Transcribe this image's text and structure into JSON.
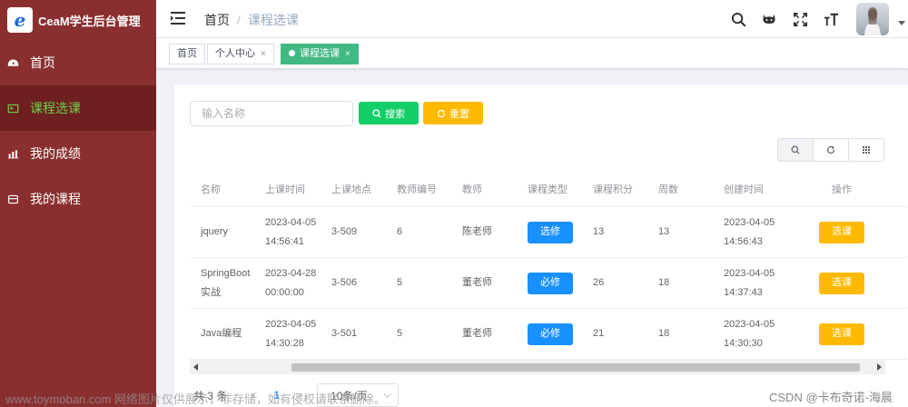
{
  "app": {
    "logo_letter": "e",
    "title": "CeaM学生后台管理"
  },
  "sidebar": {
    "items": [
      {
        "label": "首页",
        "icon": "dashboard-icon"
      },
      {
        "label": "课程选课",
        "icon": "course-icon"
      },
      {
        "label": "我的成绩",
        "icon": "bar-chart-icon"
      },
      {
        "label": "我的课程",
        "icon": "book-icon"
      }
    ],
    "active_color": "#6cd34b",
    "bg_color": "#8a2f2f"
  },
  "header": {
    "breadcrumb": {
      "home": "首页",
      "sep": "/",
      "current": "课程选课"
    },
    "icons": [
      "search-icon",
      "github-icon",
      "fullscreen-icon",
      "font-size-icon"
    ]
  },
  "tags": [
    {
      "label": "首页",
      "active": false
    },
    {
      "label": "个人中心",
      "active": false,
      "close": "×"
    },
    {
      "label": "课程选课",
      "active": true,
      "close": "×"
    }
  ],
  "search": {
    "placeholder": "输入名称",
    "search_label": "搜索",
    "reset_label": "重置"
  },
  "table": {
    "headers": [
      "名称",
      "上课时间",
      "上课地点",
      "教师编号",
      "教师",
      "课程类型",
      "课程积分",
      "周数",
      "创建时间",
      "操作"
    ],
    "rows": [
      {
        "name": "jquery",
        "time": "2023-04-05 14:56:41",
        "location": "3-509",
        "teacher_no": "6",
        "teacher": "陈老师",
        "type": "选修",
        "credit": "13",
        "weeks": "13",
        "created": "2023-04-05 14:56:43",
        "action": "选课"
      },
      {
        "name": "SpringBoot实战",
        "time": "2023-04-28 00:00:00",
        "location": "3-506",
        "teacher_no": "5",
        "teacher": "董老师",
        "type": "必修",
        "credit": "26",
        "weeks": "18",
        "created": "2023-04-05 14:37:43",
        "action": "选课"
      },
      {
        "name": "Java编程",
        "time": "2023-04-05 14:30:28",
        "location": "3-501",
        "teacher_no": "5",
        "teacher": "董老师",
        "type": "必修",
        "credit": "21",
        "weeks": "18",
        "created": "2023-04-05 14:30:30",
        "action": "选课"
      }
    ]
  },
  "pagination": {
    "total": "共 3 条",
    "prev": "<",
    "page": "1",
    "next": ">",
    "page_size": "10条/页"
  },
  "watermark": {
    "left": "www.toymoban.com 网络图片仅供展示，非存储，如有侵权请联系删除。",
    "right": "CSDN @卡布奇诺-海晨"
  }
}
